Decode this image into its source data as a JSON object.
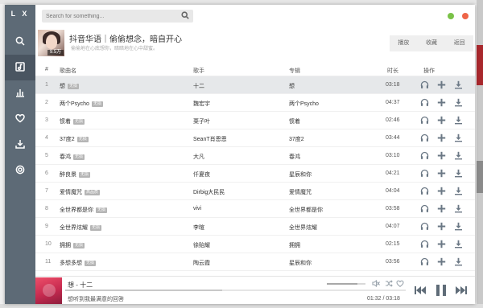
{
  "app": {
    "logo": "L X"
  },
  "sidebar": {
    "items": [
      {
        "name": "search",
        "icon": "search-icon"
      },
      {
        "name": "music-library",
        "icon": "music-library-icon",
        "active": true
      },
      {
        "name": "leaderboard",
        "icon": "bar-chart-icon"
      },
      {
        "name": "favorites",
        "icon": "heart-icon"
      },
      {
        "name": "downloads",
        "icon": "download-icon"
      },
      {
        "name": "settings",
        "icon": "gear-icon"
      }
    ]
  },
  "search": {
    "placeholder": "Search for something..."
  },
  "playlist": {
    "title": "抖音华语｜偷偷想念，暗自开心",
    "description": "偷偷地在心底想你，暗暗地在心中甜蜜。",
    "cover_count": "9.5万",
    "actions": [
      "播放",
      "收藏",
      "返回"
    ]
  },
  "table": {
    "headers": [
      "#",
      "歌曲名",
      "歌手",
      "专辑",
      "时长",
      "操作"
    ],
    "rows": [
      {
        "idx": "1",
        "name": "想",
        "tag": "无损",
        "singer": "十二",
        "album": "想",
        "duration": "03:18"
      },
      {
        "idx": "2",
        "name": "两个Psycho",
        "tag": "无损",
        "singer": "魏宏宇",
        "album": "两个Psycho",
        "duration": "04:37"
      },
      {
        "idx": "3",
        "name": "惯着",
        "tag": "无损",
        "singer": "栗子叶",
        "album": "惯着",
        "duration": "02:46"
      },
      {
        "idx": "4",
        "name": "37度2",
        "tag": "无损",
        "singer": "SeanT肖恩恩",
        "album": "37度2",
        "duration": "03:44"
      },
      {
        "idx": "5",
        "name": "春鸿",
        "tag": "无损",
        "singer": "大凡",
        "album": "春鸿",
        "duration": "03:10"
      },
      {
        "idx": "6",
        "name": "醉良景",
        "tag": "无损",
        "singer": "仟夏夜",
        "album": "星辰和你",
        "duration": "04:21"
      },
      {
        "idx": "7",
        "name": "爱情魔咒",
        "tag": "高品质",
        "singer": "Dirbig大民民",
        "album": "爱情魔咒",
        "duration": "04:04"
      },
      {
        "idx": "8",
        "name": "全世界都是你",
        "tag": "无损",
        "singer": "vivi",
        "album": "全世界都是你",
        "duration": "03:58"
      },
      {
        "idx": "9",
        "name": "全世界炫耀",
        "tag": "无损",
        "singer": "李暄",
        "album": "全世界炫耀",
        "duration": "04:07"
      },
      {
        "idx": "10",
        "name": "拥拥",
        "tag": "无损",
        "singer": "徐贻耀",
        "album": "拥拥",
        "duration": "02:15"
      },
      {
        "idx": "11",
        "name": "多想多想",
        "tag": "无损",
        "singer": "陶云霞",
        "album": "星辰和你",
        "duration": "03:56"
      }
    ]
  },
  "player": {
    "title": "想 - 十二",
    "lyric": "想听到我最满意的回答",
    "time": "01:32 / 03:18",
    "progress": 0.46,
    "volume": 0.8
  },
  "colors": {
    "sidebar": "#5d6a76",
    "sidebar_active": "#4a5561",
    "minimize": "#7ac248",
    "close": "#ee6548",
    "icon": "#6b7885"
  }
}
